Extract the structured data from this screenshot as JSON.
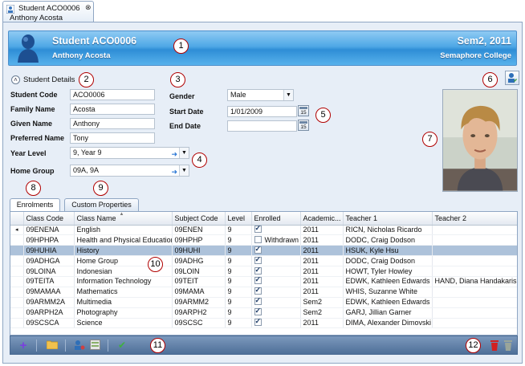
{
  "doc_tab": {
    "title": "Student ACO0006",
    "subtitle": "Anthony Acosta",
    "close": "⊗"
  },
  "header": {
    "title": "Student ACO0006",
    "name": "Anthony Acosta",
    "semester": "Sem2, 2011",
    "school": "Semaphore College"
  },
  "section": {
    "toggle": "˄",
    "title": "Student Details"
  },
  "fields": {
    "student_code": {
      "label": "Student Code",
      "value": "ACO0006"
    },
    "family_name": {
      "label": "Family Name",
      "value": "Acosta"
    },
    "given_name": {
      "label": "Given Name",
      "value": "Anthony"
    },
    "preferred_name": {
      "label": "Preferred Name",
      "value": "Tony"
    },
    "year_level": {
      "label": "Year Level",
      "value": "9, Year 9"
    },
    "home_group": {
      "label": "Home Group",
      "value": "09A, 9A"
    },
    "gender": {
      "label": "Gender",
      "value": "Male"
    },
    "start_date": {
      "label": "Start Date",
      "value": "1/01/2009"
    },
    "end_date": {
      "label": "End Date",
      "value": ""
    },
    "calendar_day": "15"
  },
  "tabs": [
    "Enrolments",
    "Custom Properties"
  ],
  "grid": {
    "columns": [
      "Class Code",
      "Class Name",
      "Subject Code",
      "Level",
      "Enrolled",
      "Academic...",
      "Teacher 1",
      "Teacher 2"
    ],
    "rows": [
      {
        "code": "09ENENA",
        "name": "English",
        "subject": "09ENEN",
        "level": "9",
        "enrolled": true,
        "status": "",
        "academic": "2011",
        "t1": "RICN, Nicholas Ricardo",
        "t2": ""
      },
      {
        "code": "09HPHPA",
        "name": "Health and Physical Education",
        "subject": "09HPHP",
        "level": "9",
        "enrolled": false,
        "status": "Withdrawn",
        "academic": "2011",
        "t1": "DODC, Craig Dodson",
        "t2": ""
      },
      {
        "code": "09HUHIA",
        "name": "History",
        "subject": "09HUHI",
        "level": "9",
        "enrolled": true,
        "status": "",
        "academic": "2011",
        "t1": "HSUK, Kyle Hsu",
        "t2": ""
      },
      {
        "code": "09ADHGA",
        "name": "Home Group",
        "subject": "09ADHG",
        "level": "9",
        "enrolled": true,
        "status": "",
        "academic": "2011",
        "t1": "DODC, Craig Dodson",
        "t2": ""
      },
      {
        "code": "09LOINA",
        "name": "Indonesian",
        "subject": "09LOIN",
        "level": "9",
        "enrolled": true,
        "status": "",
        "academic": "2011",
        "t1": "HOWT, Tyler Howley",
        "t2": ""
      },
      {
        "code": "09TEITA",
        "name": "Information Technology",
        "subject": "09TEIT",
        "level": "9",
        "enrolled": true,
        "status": "",
        "academic": "2011",
        "t1": "EDWK, Kathleen Edwards",
        "t2": "HAND, Diana Handakaris"
      },
      {
        "code": "09MAMAA",
        "name": "Mathematics",
        "subject": "09MAMA",
        "level": "9",
        "enrolled": true,
        "status": "",
        "academic": "2011",
        "t1": "WHIS, Suzanne White",
        "t2": ""
      },
      {
        "code": "09ARMM2A",
        "name": "Multimedia",
        "subject": "09ARMM2",
        "level": "9",
        "enrolled": true,
        "status": "",
        "academic": "Sem2",
        "t1": "EDWK, Kathleen Edwards",
        "t2": ""
      },
      {
        "code": "09ARPH2A",
        "name": "Photography",
        "subject": "09ARPH2",
        "level": "9",
        "enrolled": true,
        "status": "",
        "academic": "Sem2",
        "t1": "GARJ, Jillian Garner",
        "t2": ""
      },
      {
        "code": "09SCSCA",
        "name": "Science",
        "subject": "09SCSC",
        "level": "9",
        "enrolled": true,
        "status": "",
        "academic": "2011",
        "t1": "DIMA, Alexander Dimovski",
        "t2": ""
      }
    ],
    "selected_row": 2,
    "sort_indicator": "▲",
    "row_indicator": "◂"
  },
  "callouts": [
    "1",
    "2",
    "3",
    "4",
    "5",
    "6",
    "7",
    "8",
    "9",
    "10",
    "11",
    "12"
  ],
  "toolbar_icons": {
    "add": "+",
    "folder": "▬",
    "check": "✔",
    "delete": "✖"
  },
  "colors": {
    "banner": "#4ea8e6",
    "selected_row": "#adc2da",
    "callout_border": "#b00000",
    "toolbar": "#5f81ab"
  }
}
